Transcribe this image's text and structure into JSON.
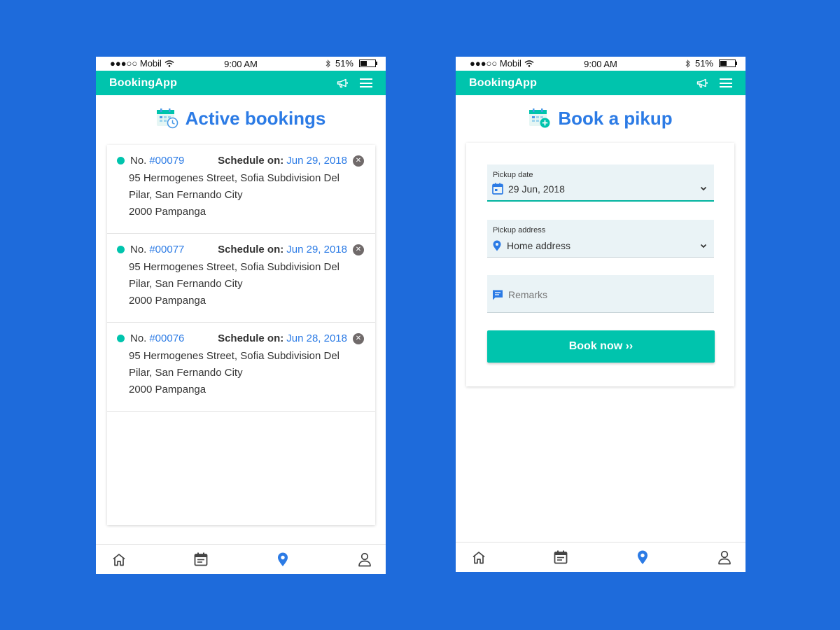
{
  "status_bar": {
    "carrier": "●●●○○ Mobil",
    "time": "9:00 AM",
    "battery": "51%"
  },
  "app": {
    "title": "BookingApp"
  },
  "left_screen": {
    "heading": "Active bookings",
    "bookings": [
      {
        "no_label": "No.",
        "number": "#00079",
        "schedule_label": "Schedule on:",
        "date": "Jun 29, 2018",
        "address_line1": "95 Hermogenes Street, Sofia Subdivision Del",
        "address_line2": "Pilar, San Fernando City",
        "address_line3": "2000 Pampanga"
      },
      {
        "no_label": "No.",
        "number": "#00077",
        "schedule_label": "Schedule on:",
        "date": "Jun 29, 2018",
        "address_line1": "95 Hermogenes Street, Sofia Subdivision Del",
        "address_line2": "Pilar, San Fernando City",
        "address_line3": "2000 Pampanga"
      },
      {
        "no_label": "No.",
        "number": "#00076",
        "schedule_label": "Schedule on:",
        "date": "Jun 28, 2018",
        "address_line1": "95 Hermogenes Street, Sofia Subdivision Del",
        "address_line2": "Pilar, San Fernando City",
        "address_line3": "2000 Pampanga"
      }
    ]
  },
  "right_screen": {
    "heading": "Book a pikup",
    "pickup_date": {
      "label": "Pickup date",
      "value": "29 Jun, 2018"
    },
    "pickup_address": {
      "label": "Pickup address",
      "value": "Home address"
    },
    "remarks": {
      "placeholder": "Remarks"
    },
    "book_button": "Book now ››"
  },
  "colors": {
    "background": "#1e6bdb",
    "accent": "#00c4ad",
    "link": "#2c7be5",
    "active_nav": "#2c7be5"
  },
  "bottom_nav": {
    "items": [
      "home-icon",
      "calendar-icon",
      "location-pin-icon",
      "user-icon"
    ],
    "active": "location-pin-icon"
  }
}
